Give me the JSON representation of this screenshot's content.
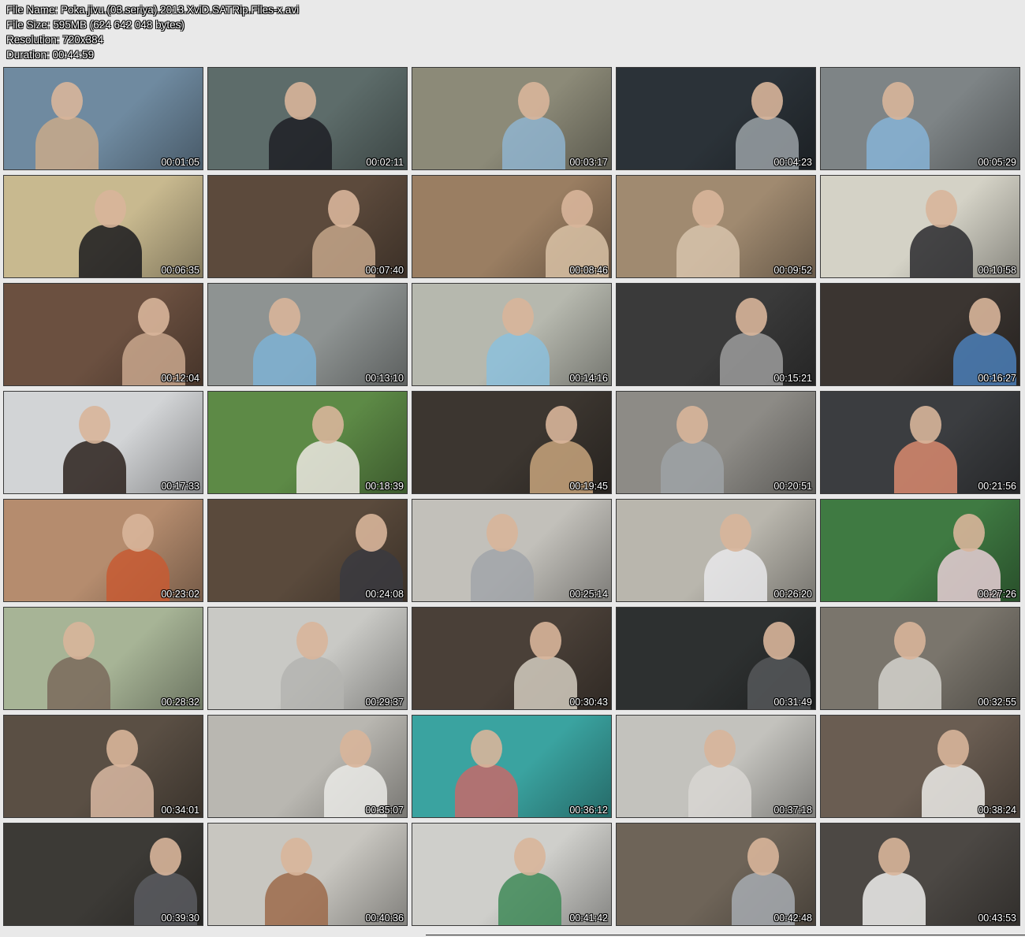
{
  "info": {
    "file_name": "File Name: Poka.jivu.(03.seriya).2013.XviD.SATRip.Files-x.avi",
    "file_size": "File Size: 595MB (624 642 048 bytes)",
    "resolution": "Resolution: 720x384",
    "duration": "Duration: 00:44:59"
  },
  "thumbnails": [
    {
      "time": "00:01:05",
      "bg": "#6f8aa0",
      "fg": "#c9a98a"
    },
    {
      "time": "00:02:11",
      "bg": "#5d6c6a",
      "fg": "#1d1f24"
    },
    {
      "time": "00:03:17",
      "bg": "#8c8a78",
      "fg": "#8fb4cf"
    },
    {
      "time": "00:04:23",
      "bg": "#2b3238",
      "fg": "#9aa1a6"
    },
    {
      "time": "00:05:29",
      "bg": "#7e8486",
      "fg": "#86b3d6"
    },
    {
      "time": "00:06:35",
      "bg": "#c8b98f",
      "fg": "#1a1a1d"
    },
    {
      "time": "00:07:40",
      "bg": "#5c4a3c",
      "fg": "#c4a68a"
    },
    {
      "time": "00:08:46",
      "bg": "#9a7e62",
      "fg": "#d9c2a6"
    },
    {
      "time": "00:09:52",
      "bg": "#a08a70",
      "fg": "#d7c3ac"
    },
    {
      "time": "00:10:58",
      "bg": "#d4d2c6",
      "fg": "#2a2a2e"
    },
    {
      "time": "00:12:04",
      "bg": "#6b5040",
      "fg": "#c9a78d"
    },
    {
      "time": "00:13:10",
      "bg": "#8e9392",
      "fg": "#7eb2d4"
    },
    {
      "time": "00:14:16",
      "bg": "#b6b8ae",
      "fg": "#8cc0dc"
    },
    {
      "time": "00:15:21",
      "bg": "#3a3a3a",
      "fg": "#9c9c9c"
    },
    {
      "time": "00:16:27",
      "bg": "#3b3531",
      "fg": "#4b7fb8"
    },
    {
      "time": "00:17:33",
      "bg": "#d2d4d6",
      "fg": "#2c211c"
    },
    {
      "time": "00:18:39",
      "bg": "#5d8a46",
      "fg": "#ece8e2"
    },
    {
      "time": "00:19:45",
      "bg": "#3c3630",
      "fg": "#c8a47c"
    },
    {
      "time": "00:20:51",
      "bg": "#8d8b86",
      "fg": "#9ea2a6"
    },
    {
      "time": "00:21:56",
      "bg": "#3b3d40",
      "fg": "#d98a6e"
    },
    {
      "time": "00:23:02",
      "bg": "#b58c6e",
      "fg": "#c75b32"
    },
    {
      "time": "00:24:08",
      "bg": "#5a4a3c",
      "fg": "#3a3a40"
    },
    {
      "time": "00:25:14",
      "bg": "#c2c0ba",
      "fg": "#a1a5a9"
    },
    {
      "time": "00:26:20",
      "bg": "#b9b6ad",
      "fg": "#e8e8ea"
    },
    {
      "time": "00:27:26",
      "bg": "#3f7a42",
      "fg": "#e7cfd6"
    },
    {
      "time": "00:28:32",
      "bg": "#a7b496",
      "fg": "#7a6a5c"
    },
    {
      "time": "00:29:37",
      "bg": "#c9c9c5",
      "fg": "#b4b4b0"
    },
    {
      "time": "00:30:43",
      "bg": "#4a4038",
      "fg": "#d4cdbf"
    },
    {
      "time": "00:31:49",
      "bg": "#2d3030",
      "fg": "#56585a"
    },
    {
      "time": "00:32:55",
      "bg": "#7a756c",
      "fg": "#d4d2cc"
    },
    {
      "time": "00:34:01",
      "bg": "#5a4f44",
      "fg": "#d9b8a2"
    },
    {
      "time": "00:35:07",
      "bg": "#b9b7b1",
      "fg": "#eaeae6"
    },
    {
      "time": "00:36:12",
      "bg": "#3aa3a0",
      "fg": "#c56a6a"
    },
    {
      "time": "00:37:18",
      "bg": "#c3c2bd",
      "fg": "#d8d6d2"
    },
    {
      "time": "00:38:24",
      "bg": "#6a5d52",
      "fg": "#ecebe7"
    },
    {
      "time": "00:39:30",
      "bg": "#3c3a36",
      "fg": "#5a5c60"
    },
    {
      "time": "00:40:36",
      "bg": "#c8c6c0",
      "fg": "#9c6a4a"
    },
    {
      "time": "00:41:42",
      "bg": "#cfcfcb",
      "fg": "#3f8a58"
    },
    {
      "time": "00:42:48",
      "bg": "#6e6458",
      "fg": "#a7acb2"
    },
    {
      "time": "00:43:53",
      "bg": "#4c4844",
      "fg": "#eeeeec"
    }
  ]
}
